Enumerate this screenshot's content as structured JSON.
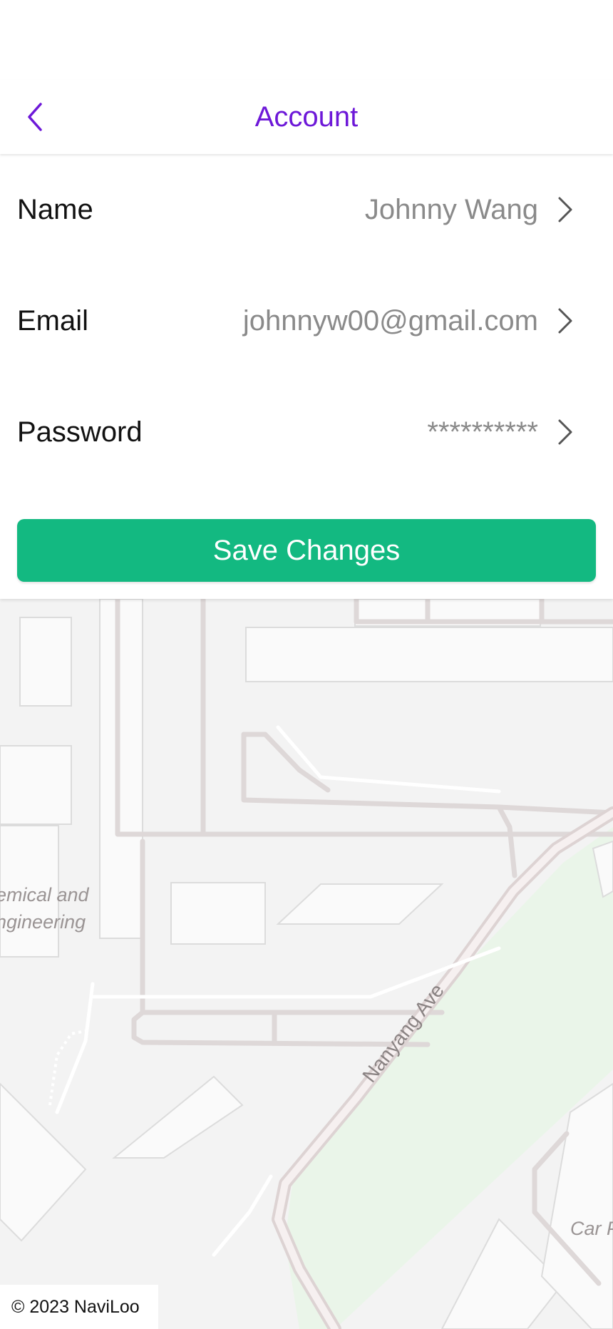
{
  "header": {
    "title": "Account",
    "back_icon": "chevron-left-icon",
    "accent_color": "#6d18d8"
  },
  "account": {
    "rows": [
      {
        "label": "Name",
        "value": "Johnny Wang"
      },
      {
        "label": "Email",
        "value": "johnnyw00@gmail.com"
      },
      {
        "label": "Password",
        "value": "**********"
      }
    ],
    "row_icon": "chevron-right-icon"
  },
  "actions": {
    "save_label": "Save Changes",
    "save_color": "#13b981"
  },
  "map": {
    "street_label": "Nanyang Ave",
    "building_label_line1": "emical and",
    "building_label_line2": "ngineering",
    "carpark_label": "Car P"
  },
  "footer": {
    "copyright": "© 2023 NaviLoo"
  }
}
